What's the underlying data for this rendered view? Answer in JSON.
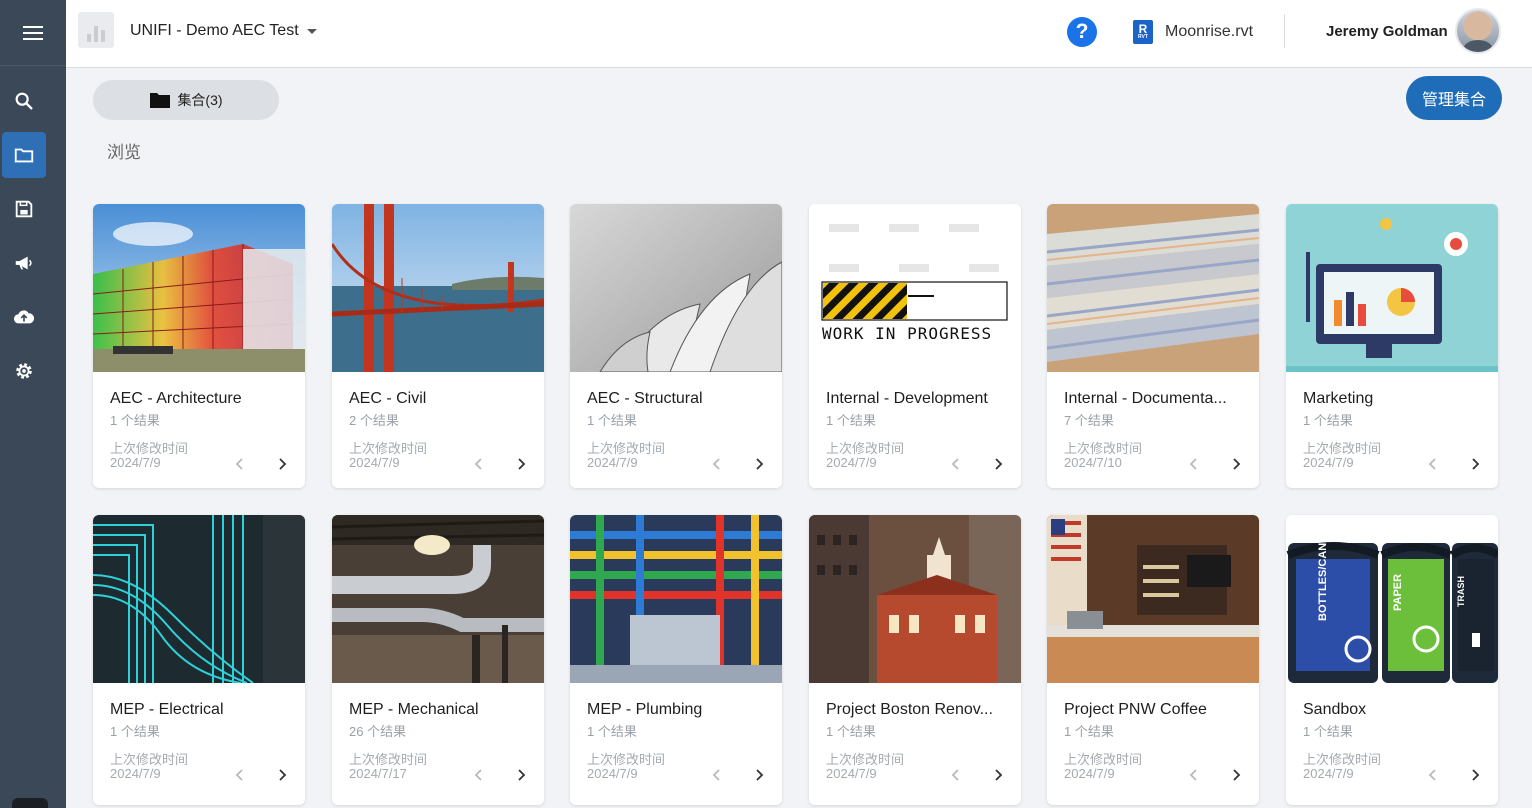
{
  "header": {
    "project_title": "UNIFI - Demo AEC Test",
    "help_label": "?",
    "file_badge": "R",
    "file_badge_sub": "RVT",
    "file_name": "Moonrise.rvt",
    "user_name": "Jeremy Goldman"
  },
  "sidebar": {
    "items": [
      {
        "icon": "search-icon"
      },
      {
        "icon": "folder-icon",
        "active": true
      },
      {
        "icon": "save-icon"
      },
      {
        "icon": "megaphone-icon"
      },
      {
        "icon": "cloud-upload-icon"
      },
      {
        "icon": "gear-icon"
      }
    ]
  },
  "toolbar": {
    "collections_label": "集合(3)",
    "manage_label": "管理集合",
    "browse_label": "浏览"
  },
  "colors": {
    "sidebar": "#3b4857",
    "accent": "#1f6db8",
    "help": "#1a73e8"
  },
  "cards": [
    {
      "name": "AEC - Architecture",
      "count": "1 个结果",
      "modified_label": "上次修改时间",
      "date": "2024/7/9"
    },
    {
      "name": "AEC - Civil",
      "count": "2 个结果",
      "modified_label": "上次修改时间",
      "date": "2024/7/9"
    },
    {
      "name": "AEC - Structural",
      "count": "1 个结果",
      "modified_label": "上次修改时间",
      "date": "2024/7/9"
    },
    {
      "name": "Internal - Development",
      "count": "1 个结果",
      "modified_label": "上次修改时间",
      "date": "2024/7/9",
      "thumb_text": "WORK IN PROGRESS"
    },
    {
      "name": "Internal - Documenta...",
      "count": "7 个结果",
      "modified_label": "上次修改时间",
      "date": "2024/7/10"
    },
    {
      "name": "Marketing",
      "count": "1 个结果",
      "modified_label": "上次修改时间",
      "date": "2024/7/9"
    },
    {
      "name": "MEP - Electrical",
      "count": "1 个结果",
      "modified_label": "上次修改时间",
      "date": "2024/7/9"
    },
    {
      "name": "MEP - Mechanical",
      "count": "26 个结果",
      "modified_label": "上次修改时间",
      "date": "2024/7/17"
    },
    {
      "name": "MEP - Plumbing",
      "count": "1 个结果",
      "modified_label": "上次修改时间",
      "date": "2024/7/9"
    },
    {
      "name": "Project Boston Renov...",
      "count": "1 个结果",
      "modified_label": "上次修改时间",
      "date": "2024/7/9"
    },
    {
      "name": "Project PNW Coffee",
      "count": "1 个结果",
      "modified_label": "上次修改时间",
      "date": "2024/7/9"
    },
    {
      "name": "Sandbox",
      "count": "1 个结果",
      "modified_label": "上次修改时间",
      "date": "2024/7/9",
      "bin_labels": [
        "BOTTLES/CANS",
        "PAPER",
        "TRASH"
      ]
    }
  ]
}
